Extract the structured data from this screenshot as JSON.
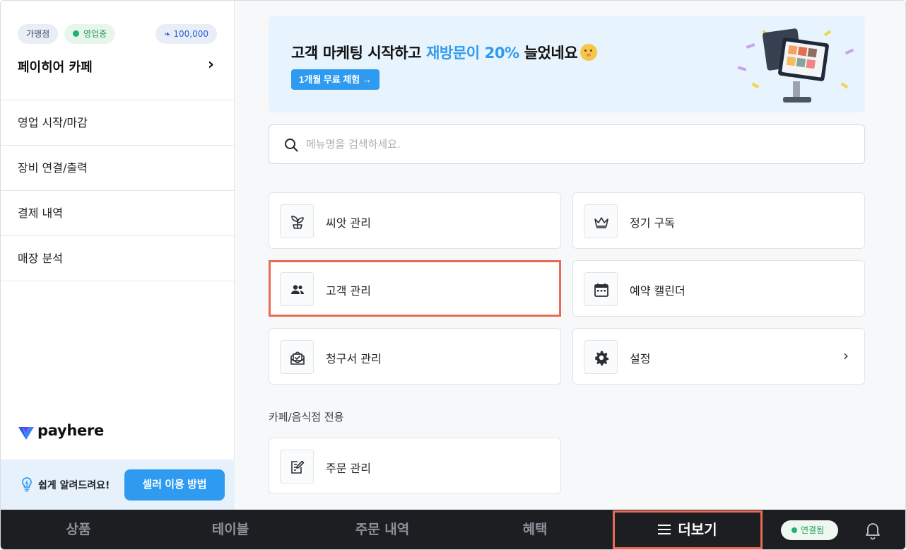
{
  "sidebar": {
    "badges": {
      "franchise": "가맹점",
      "status": "영업중",
      "points": "100,000"
    },
    "store_name": "페이히어 카페",
    "items": [
      {
        "label": "영업 시작/마감"
      },
      {
        "label": "장비 연결/출력"
      },
      {
        "label": "결제 내역"
      },
      {
        "label": "매장 분석"
      }
    ],
    "brand": "payhere",
    "help_text": "쉽게 알려드려요!",
    "help_button": "셀러 이용 방법"
  },
  "banner": {
    "title_part1": "고객 마케팅 시작하고 ",
    "title_highlight": "재방문이 20%",
    "title_part2": " 늘었네요",
    "cta": "1개월 무료 체험 →"
  },
  "search": {
    "placeholder": "메뉴명을 검색하세요."
  },
  "menu_cards": [
    {
      "label": "씨앗 관리",
      "icon": "sprout-icon"
    },
    {
      "label": "정기 구독",
      "icon": "crown-icon"
    },
    {
      "label": "고객 관리",
      "icon": "users-icon"
    },
    {
      "label": "예약 캘린더",
      "icon": "calendar-icon"
    },
    {
      "label": "청구서 관리",
      "icon": "invoice-icon"
    },
    {
      "label": "설정",
      "icon": "gear-icon"
    }
  ],
  "section": {
    "title": "카페/음식점 전용",
    "cards": [
      {
        "label": "주문 관리",
        "icon": "order-edit-icon"
      }
    ]
  },
  "bottom_nav": {
    "tabs": [
      {
        "label": "상품"
      },
      {
        "label": "테이블"
      },
      {
        "label": "주문 내역"
      },
      {
        "label": "혜택"
      }
    ],
    "more": "더보기",
    "connection": "연결됨"
  },
  "colors": {
    "accent": "#2f9bf0",
    "highlight_border": "#ea6a55",
    "nav_bg": "#1c1e22",
    "status_green": "#19b36b"
  }
}
